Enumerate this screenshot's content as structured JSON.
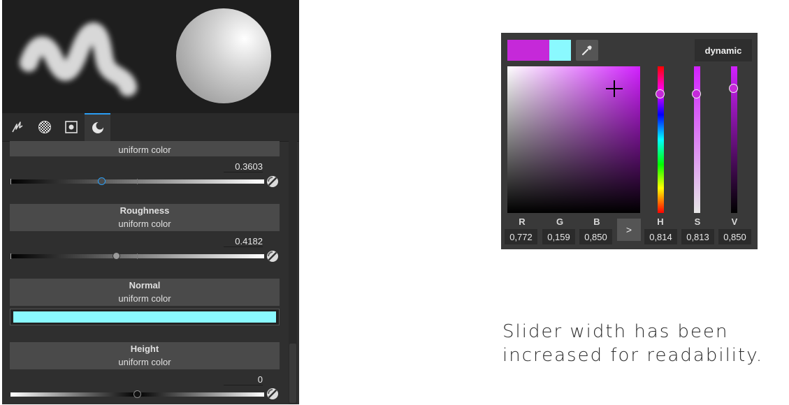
{
  "panel": {
    "tabs": [
      {
        "icon": "brush-stroke-icon",
        "active": false
      },
      {
        "icon": "checker-material-icon",
        "active": false
      },
      {
        "icon": "stencil-mask-icon",
        "active": false
      },
      {
        "icon": "sphere-material-icon",
        "active": true
      }
    ],
    "properties": [
      {
        "title": "",
        "subtitle": "uniform color",
        "value": "0.3603",
        "slider_level": 0.3603
      },
      {
        "title": "Roughness",
        "subtitle": "uniform color",
        "value": "0.4182",
        "slider_level": 0.4182
      },
      {
        "title": "Normal",
        "subtitle": "uniform color",
        "color": "#8af9ff"
      },
      {
        "title": "Height",
        "subtitle": "uniform color",
        "value": "0",
        "slider_level": 0.5
      }
    ]
  },
  "picker": {
    "current_color": "#c529d9",
    "previous_color": "#8af9ff",
    "mode_label": "dynamic",
    "arrow_label": ">",
    "rgb": [
      {
        "label": "R",
        "value": "0,772"
      },
      {
        "label": "G",
        "value": "0,159"
      },
      {
        "label": "B",
        "value": "0,850"
      }
    ],
    "hsv": [
      {
        "label": "H",
        "value": "0,814",
        "level": 0.814
      },
      {
        "label": "S",
        "value": "0,813",
        "level": 0.813
      },
      {
        "label": "V",
        "value": "0,850",
        "level": 0.85
      }
    ]
  },
  "note": {
    "line1": "Slider width has been",
    "line2": "increased for readability."
  }
}
